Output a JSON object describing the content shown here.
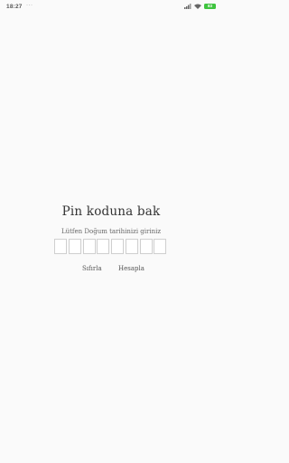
{
  "status": {
    "time": "18:27",
    "dots": "···",
    "battery": "83"
  },
  "main": {
    "title": "Pin koduna bak",
    "subtitle": "Lütfen Doğum tarihinizi giriniz",
    "pin_values": [
      "",
      "",
      "",
      "",
      "",
      "",
      "",
      ""
    ],
    "reset_label": "Sıfırla",
    "calculate_label": "Hesapla"
  },
  "colors": {
    "background": "#fafafa",
    "battery": "#3fc43f"
  }
}
